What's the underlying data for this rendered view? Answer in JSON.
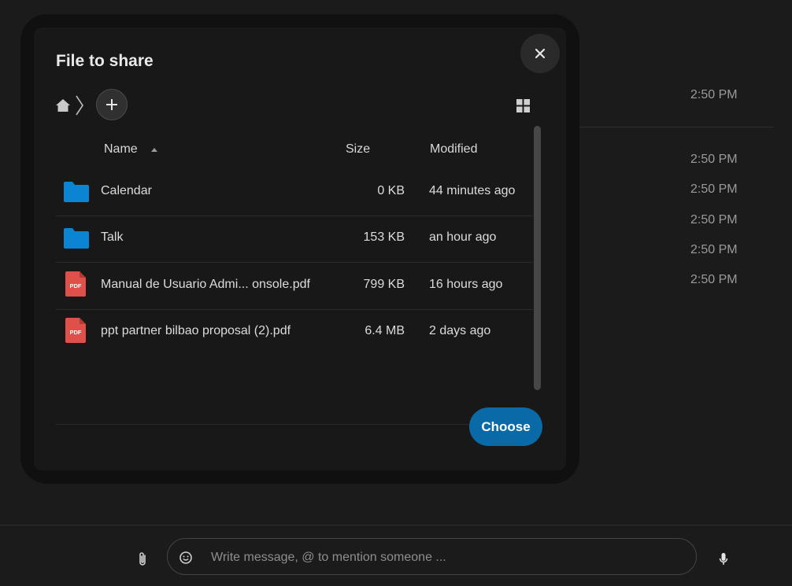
{
  "chat": {
    "timestamps": [
      "2:50 PM",
      "2:50 PM",
      "2:50 PM",
      "2:50 PM",
      "2:50 PM",
      "2:50 PM"
    ]
  },
  "composer": {
    "placeholder": "Write message, @ to mention someone ...",
    "icons": {
      "attach": "paperclip-icon",
      "emoji": "emoji-icon",
      "mic": "microphone-icon"
    }
  },
  "dialog": {
    "title": "File to share",
    "breadcrumb": {
      "home_icon": "home-icon"
    },
    "columns": {
      "name": "Name",
      "size": "Size",
      "modified": "Modified"
    },
    "files": [
      {
        "name": "Calendar",
        "size": "0 KB",
        "modified": "44 minutes ago",
        "type": "folder"
      },
      {
        "name": "Talk",
        "size": "153 KB",
        "modified": "an hour ago",
        "type": "folder"
      },
      {
        "name": "Manual de Usuario Admi... onsole.pdf",
        "size": "799 KB",
        "modified": "16 hours ago",
        "type": "pdf"
      },
      {
        "name": "ppt partner bilbao proposal (2).pdf",
        "size": "6.4 MB",
        "modified": "2 days ago",
        "type": "pdf"
      }
    ],
    "pdf_badge": "PDF",
    "choose_label": "Choose"
  },
  "colors": {
    "background": "#1b1b1b",
    "dialog": "#181818",
    "folder": "#0b84d4",
    "pdf": "#e0504a",
    "primary_button": "#0a6aa8"
  }
}
